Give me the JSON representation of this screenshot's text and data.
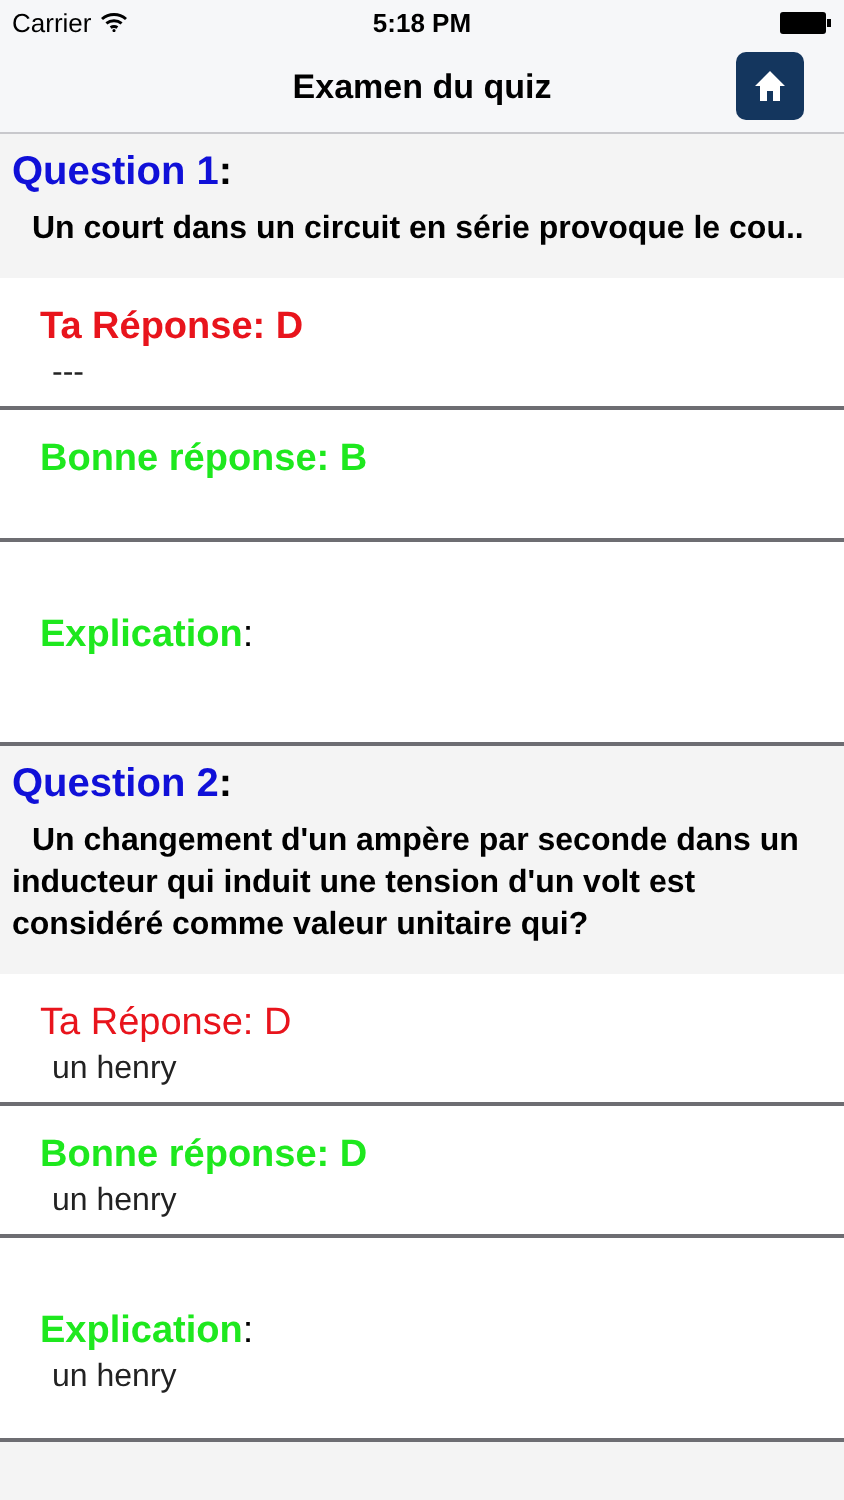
{
  "status_bar": {
    "carrier": "Carrier",
    "time": "5:18 PM"
  },
  "nav": {
    "title": "Examen du quiz"
  },
  "questions": [
    {
      "label": "Question 1",
      "separator": ":",
      "text": "Un court dans un circuit en série provoque le cou..",
      "wrap": false,
      "answers": [
        {
          "kind": "yours",
          "label": "Ta Réponse: D",
          "bold": true,
          "value": "---"
        },
        {
          "kind": "correct",
          "label": "Bonne réponse: B",
          "bold": true
        },
        {
          "kind": "explanation",
          "label": "Explication",
          "separator": ":",
          "bold": true
        }
      ]
    },
    {
      "label": "Question 2",
      "separator": ":",
      "text": "Un changement d'un ampère par seconde dans un inducteur qui induit une tension d'un volt est considéré comme valeur unitaire qui?",
      "wrap": true,
      "answers": [
        {
          "kind": "yours",
          "label": "Ta Réponse: D",
          "bold": false,
          "value": "un henry"
        },
        {
          "kind": "correct",
          "label": "Bonne réponse: D",
          "bold": true,
          "value": "un henry"
        },
        {
          "kind": "explanation",
          "label": "Explication",
          "separator": ":",
          "bold": true,
          "value": "un henry"
        }
      ]
    }
  ]
}
